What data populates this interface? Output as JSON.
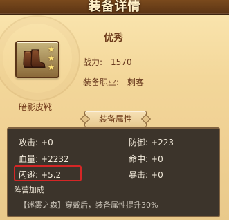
{
  "header": {
    "title": "装备详情"
  },
  "item": {
    "name": "暗影皮靴",
    "quality": "优秀",
    "power_label": "战力:",
    "power_value": "1570",
    "class_label": "装备职业:",
    "class_value": "刺客",
    "stars": 3,
    "icon": "boot-icon"
  },
  "attributes": {
    "tab_label": "装备属性",
    "attack": {
      "label": "攻击:",
      "value": "+0"
    },
    "defense": {
      "label": "防御:",
      "value": "+223"
    },
    "hp": {
      "label": "血量:",
      "value": "+2232"
    },
    "hit": {
      "label": "命中:",
      "value": "+0"
    },
    "dodge": {
      "label": "闪避:",
      "value": "+5.2"
    },
    "crit": {
      "label": "暴击:",
      "value": "+0"
    },
    "faction_title": "阵营加成",
    "faction_bonus": "【迷雾之森】穿戴后，装备属性提升30%"
  },
  "colors": {
    "highlight": "#d52626",
    "title_bar": "#6e3f1a"
  }
}
